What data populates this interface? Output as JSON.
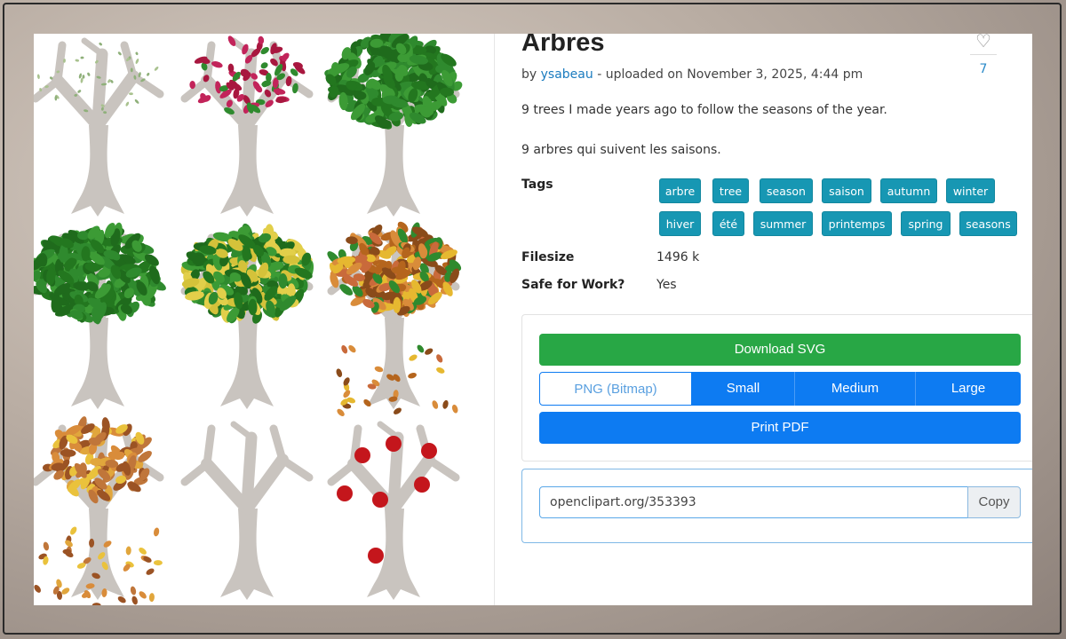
{
  "item": {
    "title": "Arbres",
    "by_prefix": "by",
    "author": "ysabeau",
    "uploaded": "- uploaded on November 3, 2025, 4:44 pm",
    "likes": "7",
    "description_en": "9 trees I made years ago to follow the seasons of the year.",
    "description_fr": "9 arbres qui suivent les saisons."
  },
  "labels": {
    "tags": "Tags",
    "filesize": "Filesize",
    "sfw": "Safe for Work?"
  },
  "tags": [
    "arbre",
    "tree",
    "season",
    "saison",
    "autumn",
    "winter",
    "hiver",
    "été",
    "summer",
    "printemps",
    "spring",
    "seasons"
  ],
  "meta": {
    "filesize": "1496 k",
    "sfw": "Yes"
  },
  "download": {
    "svg_label": "Download SVG",
    "png_label": "PNG (Bitmap)",
    "small_label": "Small",
    "medium_label": "Medium",
    "large_label": "Large",
    "pdf_label": "Print PDF"
  },
  "share": {
    "url": "openclipart.org/353393",
    "copy_label": "Copy"
  },
  "icons": {
    "like": "heart-icon"
  },
  "colors": {
    "tag_bg": "#1797b3",
    "download_green": "#28a745",
    "primary_blue": "#0d7bf2",
    "link": "#1a7bbf",
    "trunk": "#c9c4bf",
    "leaf_green": "#2f8a2e",
    "apple_red": "#c4161c"
  }
}
